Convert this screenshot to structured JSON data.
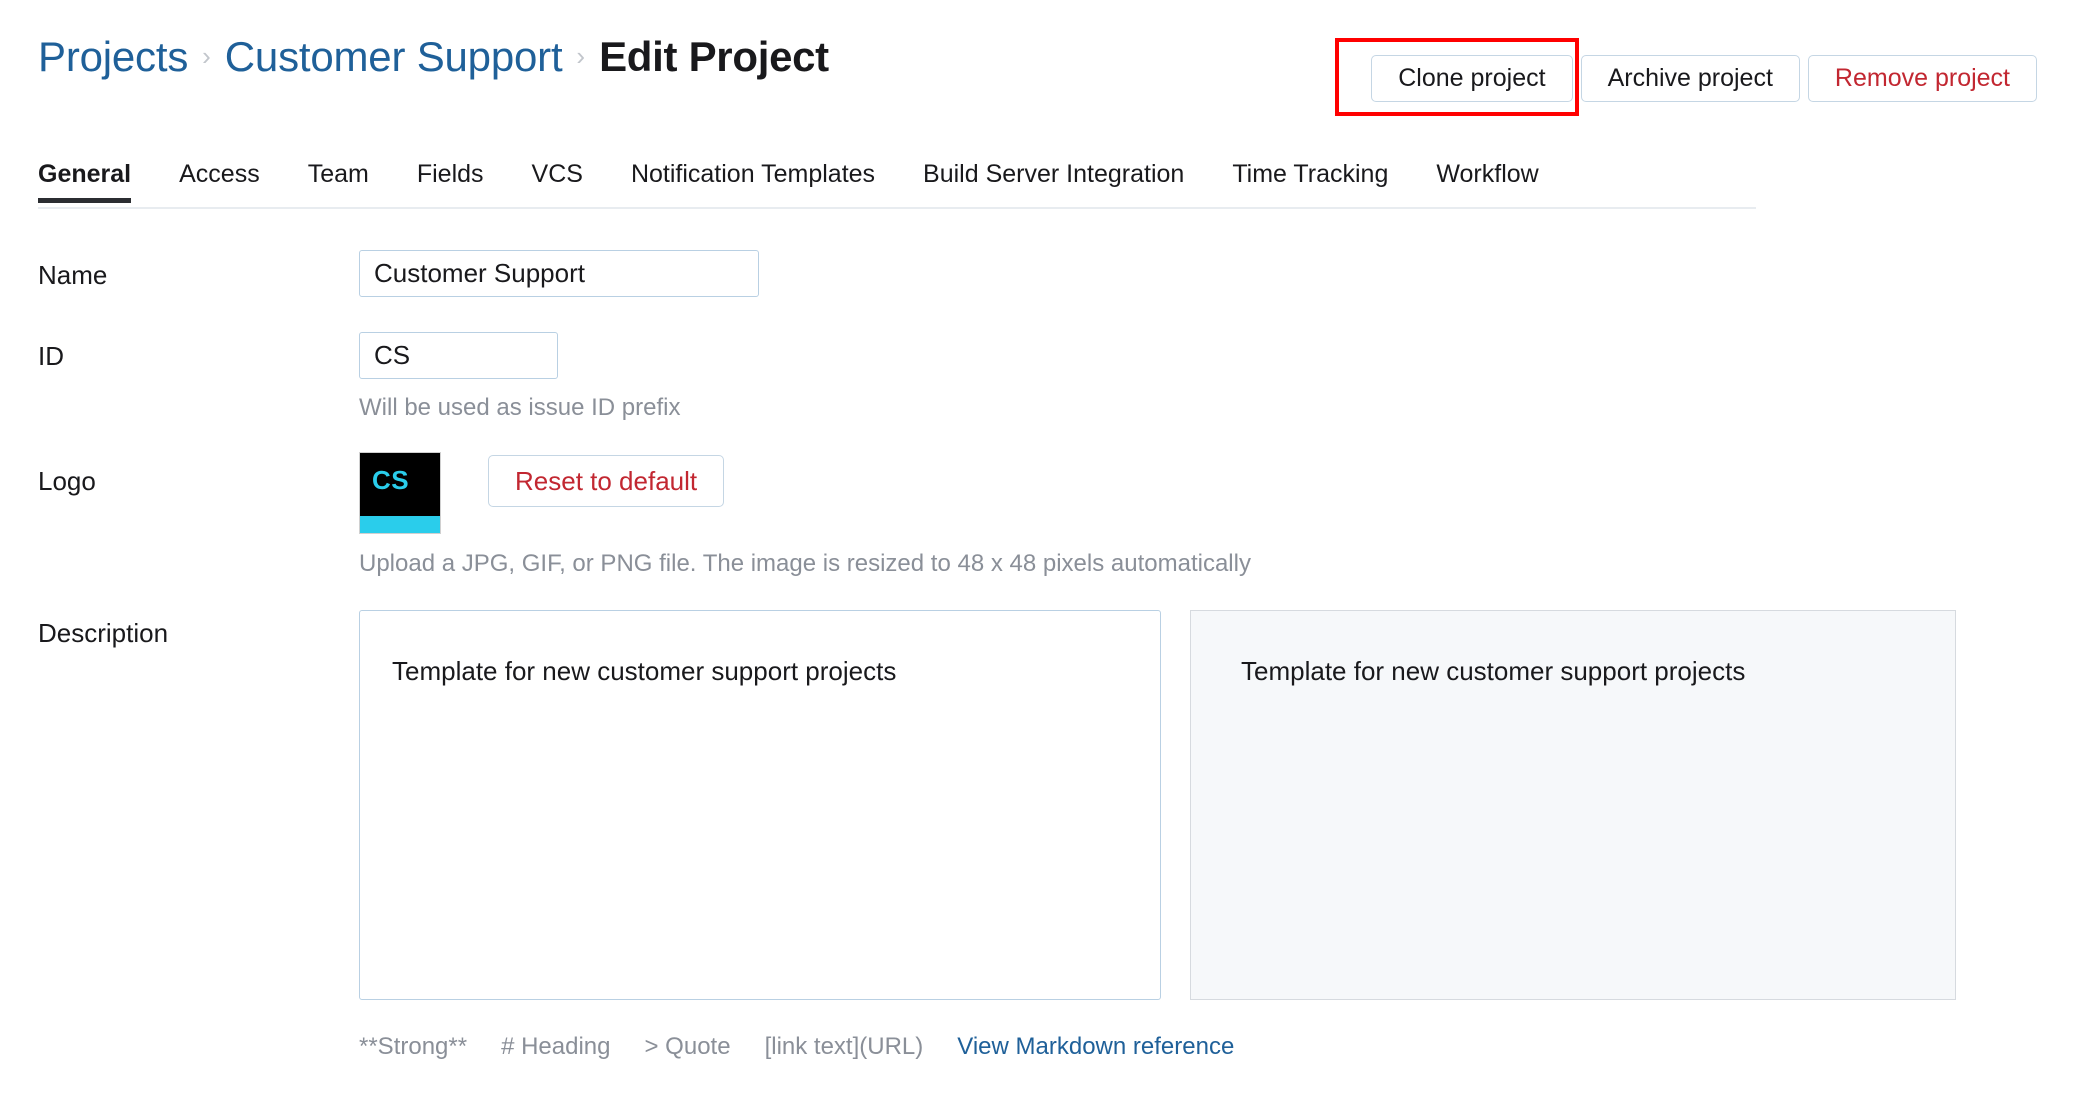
{
  "header": {
    "breadcrumb": [
      {
        "label": "Projects",
        "type": "link"
      },
      {
        "label": "Customer Support",
        "type": "link"
      },
      {
        "label": "Edit Project",
        "type": "current"
      }
    ],
    "separator": "›",
    "actions": [
      {
        "label": "Clone project",
        "style": "default",
        "highlighted": true
      },
      {
        "label": "Archive project",
        "style": "default",
        "highlighted": false
      },
      {
        "label": "Remove project",
        "style": "danger",
        "highlighted": false
      }
    ],
    "annotation_color": "#FF0000"
  },
  "tabs": {
    "active": "General",
    "items": [
      {
        "label": "General"
      },
      {
        "label": "Access"
      },
      {
        "label": "Team"
      },
      {
        "label": "Fields"
      },
      {
        "label": "VCS"
      },
      {
        "label": "Notification Templates"
      },
      {
        "label": "Build Server Integration"
      },
      {
        "label": "Time Tracking"
      },
      {
        "label": "Workflow"
      }
    ]
  },
  "form": {
    "name": {
      "label": "Name",
      "value": "Customer Support",
      "placeholder": ""
    },
    "id": {
      "label": "ID",
      "value": "CS",
      "placeholder": "",
      "hint": "Will be used as issue ID prefix"
    },
    "logo": {
      "label": "Logo",
      "initials": "CS",
      "background_color": "#000000",
      "accent_color": "#2ACDEB",
      "reset_label": "Reset to default",
      "hint": "Upload a JPG, GIF, or PNG file. The image is resized to 48 x 48 pixels automatically"
    },
    "description": {
      "label": "Description",
      "value": "Template for new customer support projects",
      "placeholder": "",
      "preview": "Template for new customer support projects",
      "markdown_hints": [
        "**Strong**",
        "# Heading",
        "> Quote",
        "[link text](URL)"
      ],
      "reference_link": "View Markdown reference"
    }
  },
  "colors": {
    "link": "#1F6099",
    "danger": "#C22731",
    "input_border": "#B9D0E3",
    "button_border": "#C5D6E4",
    "muted_text": "#8A8F98",
    "preview_bg": "#F6F8FA"
  }
}
